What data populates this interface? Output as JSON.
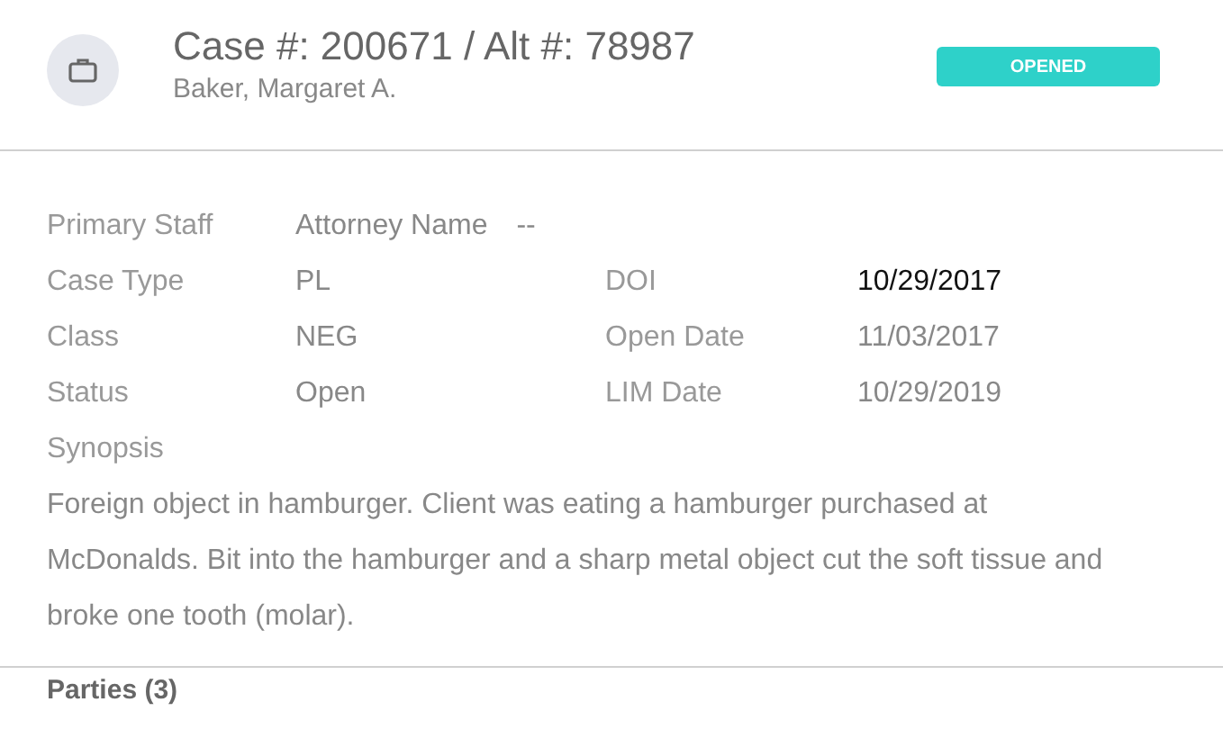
{
  "header": {
    "title": "Case #: 200671 / Alt #: 78987",
    "client": "Baker, Margaret A.",
    "badge": "OPENED"
  },
  "primary_staff": {
    "label": "Primary Staff",
    "value": "Attorney Name",
    "extra": "--"
  },
  "rows": [
    {
      "left": {
        "label": "Case Type",
        "value": "PL"
      },
      "right": {
        "label": "DOI",
        "value": "10/29/2017",
        "highlighted": true
      }
    },
    {
      "left": {
        "label": "Class",
        "value": "NEG"
      },
      "right": {
        "label": "Open Date",
        "value": "11/03/2017",
        "highlighted": false
      }
    },
    {
      "left": {
        "label": "Status",
        "value": "Open"
      },
      "right": {
        "label": "LIM Date",
        "value": "10/29/2019",
        "highlighted": false
      }
    }
  ],
  "synopsis": {
    "label": "Synopsis",
    "text": "Foreign object in hamburger. Client was eating a hamburger purchased at McDonalds. Bit into the hamburger and a sharp metal object cut the soft tissue and broke one tooth (molar)."
  },
  "parties": {
    "heading": "Parties (3)"
  }
}
